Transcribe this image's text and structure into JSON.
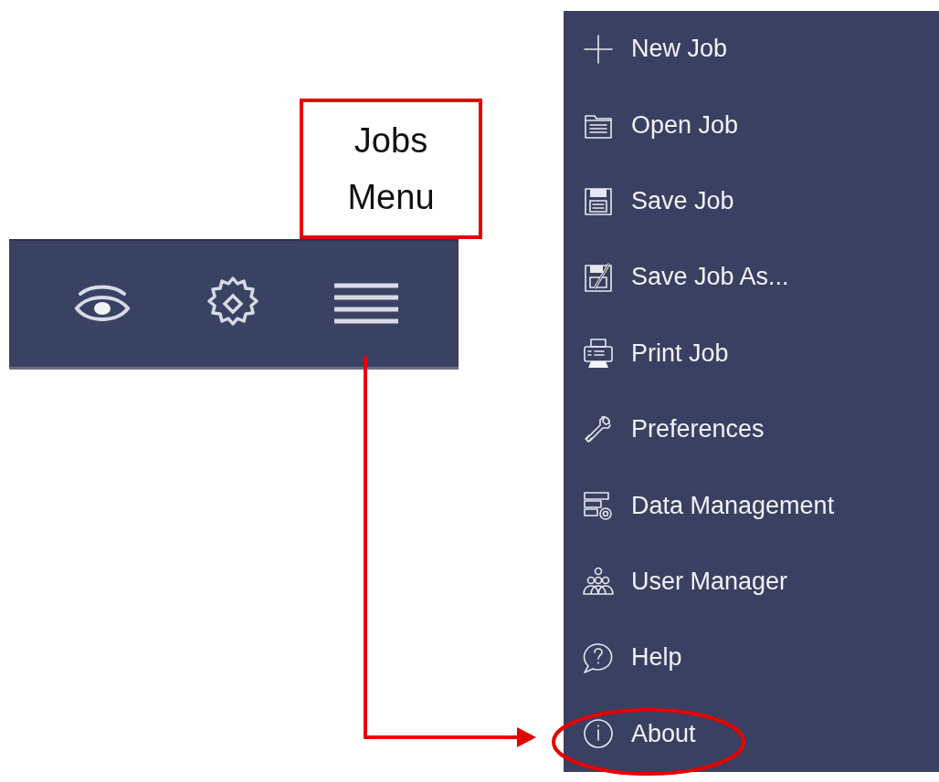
{
  "callout": {
    "lines": [
      "Jobs",
      "Menu"
    ]
  },
  "toolbar": {
    "buttons": [
      {
        "kind": "eye"
      },
      {
        "kind": "gear"
      },
      {
        "kind": "menu"
      }
    ]
  },
  "jobs_menu": {
    "items": [
      {
        "kind": "plus",
        "label": "New Job",
        "circled": false
      },
      {
        "kind": "folder",
        "label": "Open Job",
        "circled": false
      },
      {
        "kind": "save",
        "label": "Save Job",
        "circled": false
      },
      {
        "kind": "save-as",
        "label": "Save Job As...",
        "circled": false
      },
      {
        "kind": "print",
        "label": "Print Job",
        "circled": false
      },
      {
        "kind": "wrench",
        "label": "Preferences",
        "circled": false
      },
      {
        "kind": "data",
        "label": "Data Management",
        "circled": false
      },
      {
        "kind": "users",
        "label": "User Manager",
        "circled": false
      },
      {
        "kind": "help",
        "label": "Help",
        "circled": false
      },
      {
        "kind": "info",
        "label": "About",
        "circled": true
      }
    ]
  }
}
